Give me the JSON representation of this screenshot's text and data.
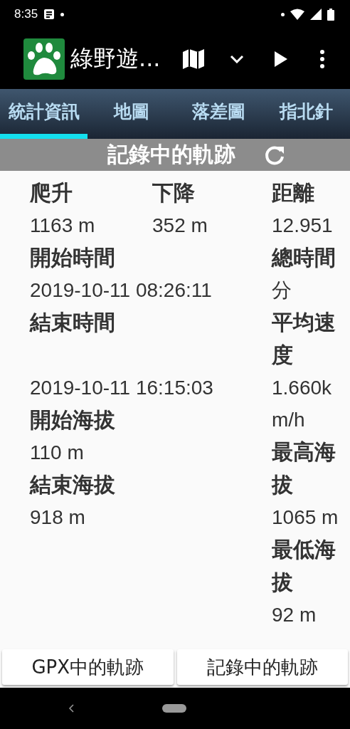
{
  "status_bar": {
    "time": "8:35"
  },
  "app_bar": {
    "title": "綠野遊..."
  },
  "tabs": [
    {
      "label": "統計資訊",
      "selected": true
    },
    {
      "label": "地圖",
      "selected": false
    },
    {
      "label": "落差圖",
      "selected": false
    },
    {
      "label": "指北針",
      "selected": false
    }
  ],
  "section": {
    "title": "記錄中的軌跡"
  },
  "stats": [
    {
      "label": "爬升",
      "value": "1163 m"
    },
    {
      "label": "下降",
      "value": "352 m"
    },
    {
      "label": "距離",
      "value": "12.951"
    },
    {
      "label": "開始時間",
      "value": "2019-10-11 08:26:11"
    },
    {
      "label": "總時間",
      "value": "分"
    },
    {
      "label": "結束時間",
      "value": "2019-10-11 16:15:03"
    },
    {
      "label": "平均速度",
      "value": "1.660km/h"
    },
    {
      "label": "開始海拔",
      "value": "110 m"
    },
    {
      "label": "結束海拔",
      "value": "918 m"
    },
    {
      "label": "最高海拔",
      "value": "1065 m"
    },
    {
      "label": "最低海拔",
      "value": "92 m"
    }
  ],
  "buttons": [
    "GPX中的軌跡",
    "記錄中的軌跡"
  ]
}
